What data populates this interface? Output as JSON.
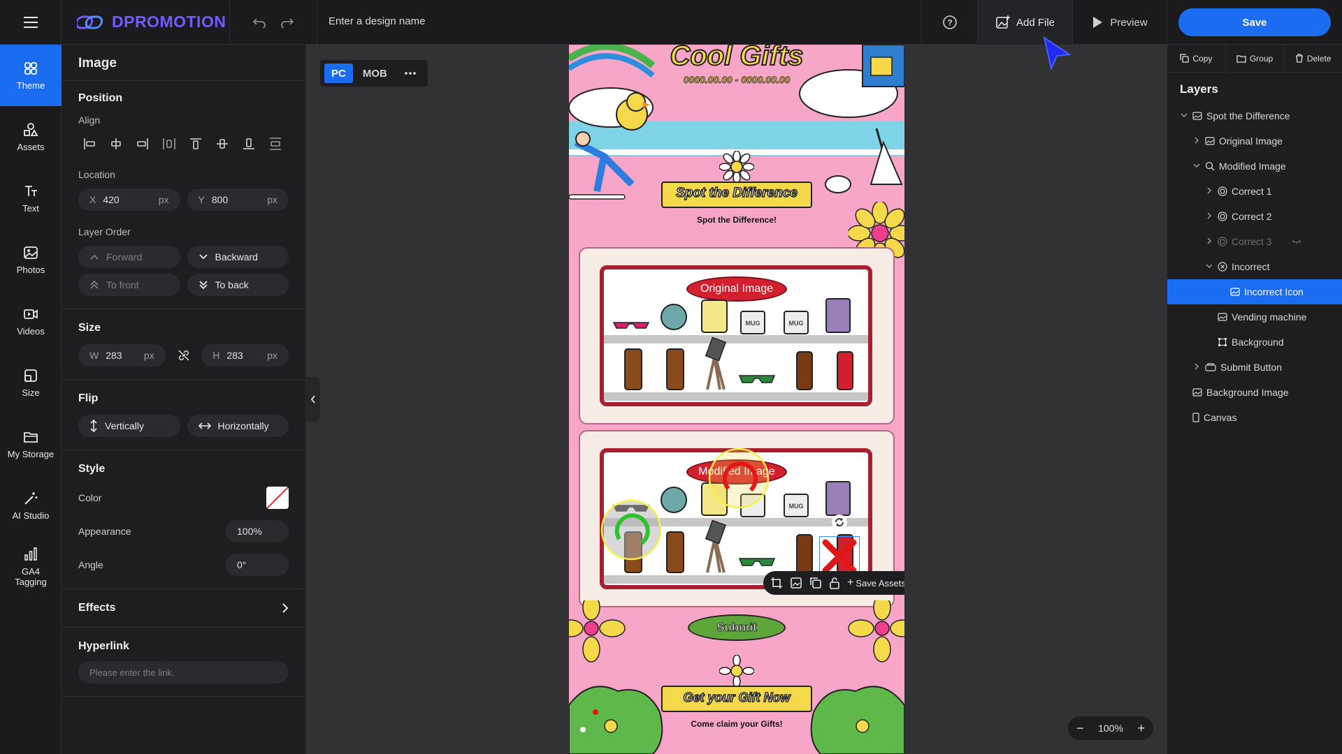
{
  "topbar": {
    "brand": "DPROMOTION",
    "design_name_placeholder": "Enter a design name",
    "add_file_label": "Add File",
    "preview_label": "Preview",
    "save_label": "Save"
  },
  "rail": [
    {
      "label": "Theme",
      "icon": "theme-icon",
      "active": true
    },
    {
      "label": "Assets",
      "icon": "assets-icon"
    },
    {
      "label": "Text",
      "icon": "text-icon"
    },
    {
      "label": "Photos",
      "icon": "photos-icon"
    },
    {
      "label": "Videos",
      "icon": "videos-icon"
    },
    {
      "label": "Size",
      "icon": "size-icon"
    },
    {
      "label": "My Storage",
      "icon": "folder-icon"
    },
    {
      "label": "AI Studio",
      "icon": "magic-wand-icon"
    },
    {
      "label": "GA4 Tagging",
      "icon": "chart-bar-icon"
    }
  ],
  "props": {
    "title": "Image",
    "position_title": "Position",
    "align_label": "Align",
    "location_label": "Location",
    "x_key": "X",
    "x_value": "420",
    "x_unit": "px",
    "y_key": "Y",
    "y_value": "800",
    "y_unit": "px",
    "layer_order_label": "Layer Order",
    "forward_label": "Forward",
    "backward_label": "Backward",
    "to_front_label": "To front",
    "to_back_label": "To back",
    "size_title": "Size",
    "w_key": "W",
    "w_value": "283",
    "w_unit": "px",
    "h_key": "H",
    "h_value": "283",
    "h_unit": "px",
    "flip_title": "Flip",
    "vertically_label": "Vertically",
    "horizontally_label": "Horizontally",
    "style_title": "Style",
    "color_label": "Color",
    "appearance_label": "Appearance",
    "appearance_value": "100%",
    "angle_label": "Angle",
    "angle_value": "0°",
    "effects_label": "Effects",
    "hyperlink_title": "Hyperlink",
    "hyperlink_placeholder": "Please enter the link."
  },
  "canvas": {
    "device_pc": "PC",
    "device_mob": "MOB",
    "zoom_value": "100%",
    "artboard": {
      "headline": "Cool Gifts",
      "date_range": "0000.00.00 - 0000.00.00",
      "banner_title": "Spot the Difference",
      "banner_subtitle": "Spot the Difference!",
      "original_label": "Original Image",
      "modified_label": "Modified Image",
      "mug_text": "MUG",
      "submit_label": "Submit",
      "gift_title": "Get your Gift Now",
      "gift_subtitle": "Come claim your Gifts!"
    },
    "floating_toolbar": {
      "save_assets_label": "Save Assets"
    }
  },
  "layers_panel": {
    "copy_label": "Copy",
    "group_label": "Group",
    "delete_label": "Delete",
    "title": "Layers",
    "items": [
      {
        "label": "Spot the Difference",
        "depth": 0,
        "chevron": "down",
        "icon": "image-icon"
      },
      {
        "label": "Original Image",
        "depth": 1,
        "chevron": "right",
        "icon": "image-icon"
      },
      {
        "label": "Modified Image",
        "depth": 1,
        "chevron": "down",
        "icon": "search-icon"
      },
      {
        "label": "Correct 1",
        "depth": 2,
        "chevron": "right",
        "icon": "target-icon"
      },
      {
        "label": "Correct 2",
        "depth": 2,
        "chevron": "right",
        "icon": "target-icon"
      },
      {
        "label": "Correct 3",
        "depth": 2,
        "chevron": "right",
        "icon": "target-icon",
        "hidden": true
      },
      {
        "label": "Incorrect",
        "depth": 2,
        "chevron": "down",
        "icon": "x-circle-icon"
      },
      {
        "label": "Incorrect Icon",
        "depth": 3,
        "chevron": "",
        "icon": "image-icon",
        "selected": true
      },
      {
        "label": "Vending machine",
        "depth": 2,
        "chevron": "",
        "icon": "image-icon"
      },
      {
        "label": "Background",
        "depth": 2,
        "chevron": "",
        "icon": "frame-icon"
      },
      {
        "label": "Submit Button",
        "depth": 1,
        "chevron": "right",
        "icon": "button-icon"
      },
      {
        "label": "Background Image",
        "depth": 0,
        "chevron": "",
        "icon": "image-icon"
      },
      {
        "label": "Canvas",
        "depth": 0,
        "chevron": "",
        "icon": "page-icon"
      }
    ]
  },
  "colors": {
    "accent": "#1a6cf0",
    "brand": "#6d5cff",
    "artboard_bg": "#f7a6c8",
    "banner_yellow": "#f6d94a",
    "banner_red": "#d3202e",
    "submit_green": "#5fa63a"
  }
}
